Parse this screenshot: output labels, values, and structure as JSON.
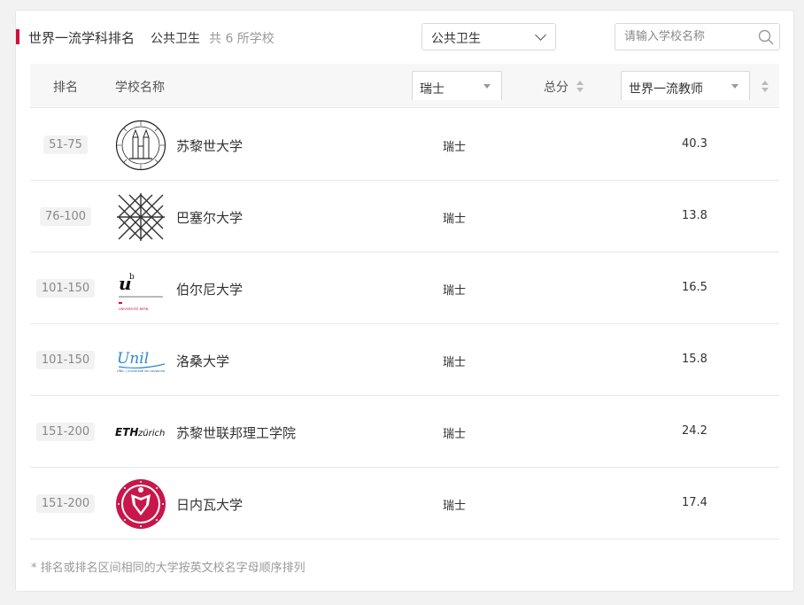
{
  "header": {
    "title": "世界一流学科排名",
    "subject": "公共卫生",
    "count": "共 6 所学校",
    "subject_select": "公共卫生",
    "search_placeholder": "请输入学校名称"
  },
  "table": {
    "col_rank": "排名",
    "col_school": "学校名称",
    "col_country_filter": "瑞士",
    "col_total": "总分",
    "col_indicator_filter": "世界一流教师",
    "rows": [
      {
        "rank": "51-75",
        "name": "苏黎世大学",
        "country": "瑞士",
        "score": "40.3",
        "logo": "uzh-seal-icon"
      },
      {
        "rank": "76-100",
        "name": "巴塞尔大学",
        "country": "瑞士",
        "score": "13.8",
        "logo": "basel-lattice-icon"
      },
      {
        "rank": "101-150",
        "name": "伯尔尼大学",
        "country": "瑞士",
        "score": "16.5",
        "logo": "bern-ub-icon"
      },
      {
        "rank": "101-150",
        "name": "洛桑大学",
        "country": "瑞士",
        "score": "15.8",
        "logo": "unil-wordmark-icon"
      },
      {
        "rank": "151-200",
        "name": "苏黎世联邦理工学院",
        "country": "瑞士",
        "score": "24.2",
        "logo": "eth-wordmark-icon"
      },
      {
        "rank": "151-200",
        "name": "日内瓦大学",
        "country": "瑞士",
        "score": "17.4",
        "logo": "geneva-seal-icon"
      }
    ]
  },
  "logo_text": {
    "eth_bold": "ETH",
    "eth_italic": "zürich",
    "unil": "Unil",
    "unil_small": "UNIL | Université de Lausanne",
    "bern_u": "u",
    "bern_b": "b",
    "bern_small": "UNIVERSITÄT BERN"
  },
  "footer": {
    "note": "* 排名或排名区间相同的大学按英文校名字母顺序排列"
  },
  "colors": {
    "accent": "#d0103a",
    "geneva": "#c8174a",
    "unil_blue": "#2b8ad0"
  }
}
